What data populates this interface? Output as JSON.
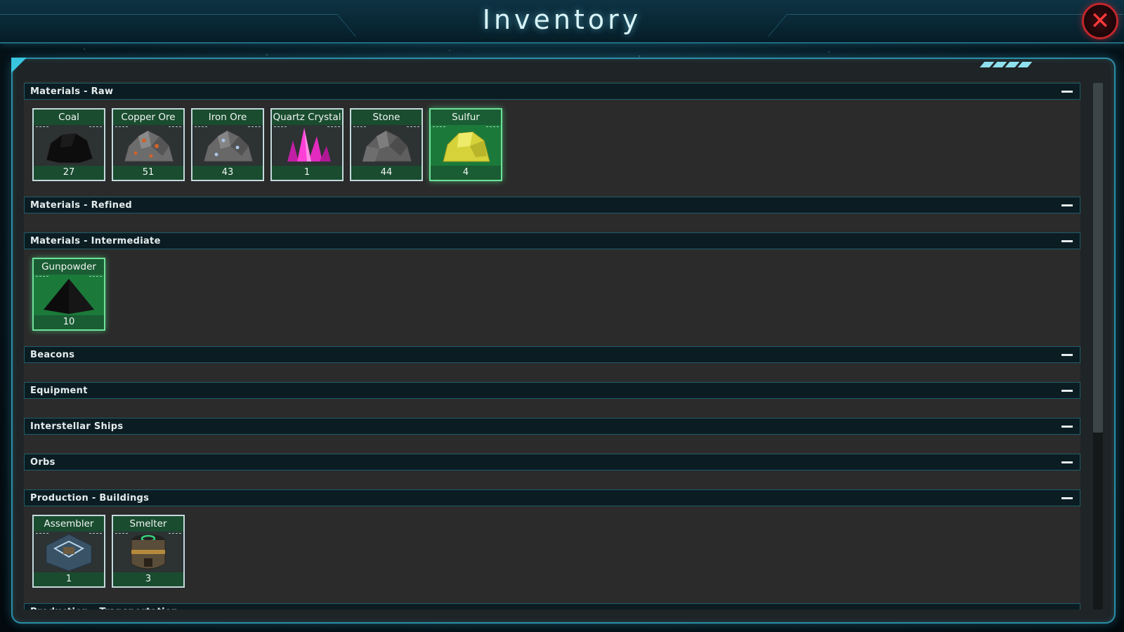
{
  "window": {
    "title": "Inventory",
    "close_icon": "close-x-icon"
  },
  "colors": {
    "frame_accent": "#2a8ea9",
    "header_bg": "#0b1c22",
    "tile_label_bg": "#1a4c2f",
    "highlight_tile": "#1b7a3a",
    "close_red": "#c0262b"
  },
  "sections": [
    {
      "title": "Materials - Raw",
      "items": [
        {
          "name": "Coal",
          "count": "27",
          "icon": "coal-icon",
          "highlight": false
        },
        {
          "name": "Copper Ore",
          "count": "51",
          "icon": "copper-ore-icon",
          "highlight": false
        },
        {
          "name": "Iron Ore",
          "count": "43",
          "icon": "iron-ore-icon",
          "highlight": false
        },
        {
          "name": "Quartz Crystal",
          "count": "1",
          "icon": "quartz-crystal-icon",
          "highlight": false
        },
        {
          "name": "Stone",
          "count": "44",
          "icon": "stone-icon",
          "highlight": false
        },
        {
          "name": "Sulfur",
          "count": "4",
          "icon": "sulfur-icon",
          "highlight": true
        }
      ]
    },
    {
      "title": "Materials - Refined",
      "items": []
    },
    {
      "title": "Materials - Intermediate",
      "items": [
        {
          "name": "Gunpowder",
          "count": "10",
          "icon": "gunpowder-icon",
          "highlight": true
        }
      ]
    },
    {
      "title": "Beacons",
      "items": []
    },
    {
      "title": "Equipment",
      "items": []
    },
    {
      "title": "Interstellar Ships",
      "items": []
    },
    {
      "title": "Orbs",
      "items": []
    },
    {
      "title": "Production - Buildings",
      "items": [
        {
          "name": "Assembler",
          "count": "1",
          "icon": "assembler-icon",
          "highlight": false
        },
        {
          "name": "Smelter",
          "count": "3",
          "icon": "smelter-icon",
          "highlight": false
        }
      ]
    },
    {
      "title": "Production - Transportation",
      "items": []
    }
  ]
}
